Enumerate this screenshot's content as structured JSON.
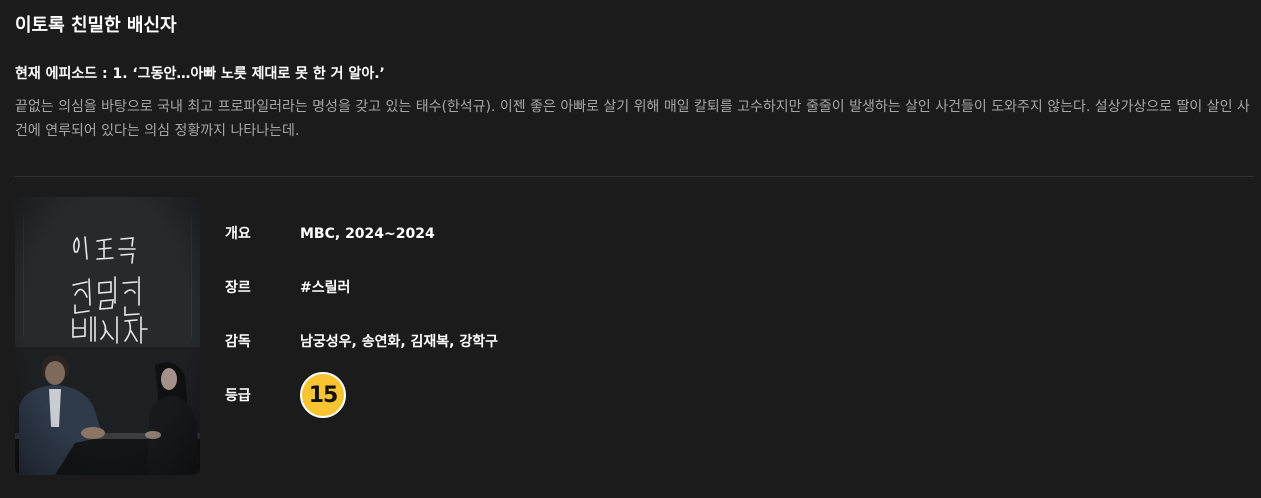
{
  "program": {
    "title": "이토록 친밀한 배신자",
    "episode_label": "현재 에피소드 : 1. ‘그동안…아빠 노릇 제대로 못 한 거 알아.’",
    "synopsis": "끝없는 의심을 바탕으로 국내 최고 프로파일러라는 명성을 갖고 있는 태수(한석규). 이젠 좋은 아빠로 살기 위해 매일 칼퇴를 고수하지만 줄줄이 발생하는 살인 사건들이 도와주지 않는다. 설상가상으로 딸이 살인 사건에 연루되어 있다는 의심 정황까지 나타나는데."
  },
  "poster": {
    "title_art": "이토록 친밀한 배신자",
    "title_lines": [
      "이토록",
      "친밀한",
      "배신자"
    ]
  },
  "details": {
    "overview": {
      "label": "개요",
      "value": "MBC, 2024~2024"
    },
    "genre": {
      "label": "장르",
      "value": "#스릴러"
    },
    "director": {
      "label": "감독",
      "value": "남궁성우, 송연화, 김재복, 강학구"
    },
    "rating": {
      "label": "등급",
      "value": "15",
      "icon": "age-rating-15-icon",
      "color": "#f8c431"
    }
  },
  "colors": {
    "background": "#1b1b1b",
    "text_primary": "#ffffff",
    "text_secondary": "#a6a6a6",
    "divider": "#333333",
    "rating_badge": "#f8c431"
  }
}
